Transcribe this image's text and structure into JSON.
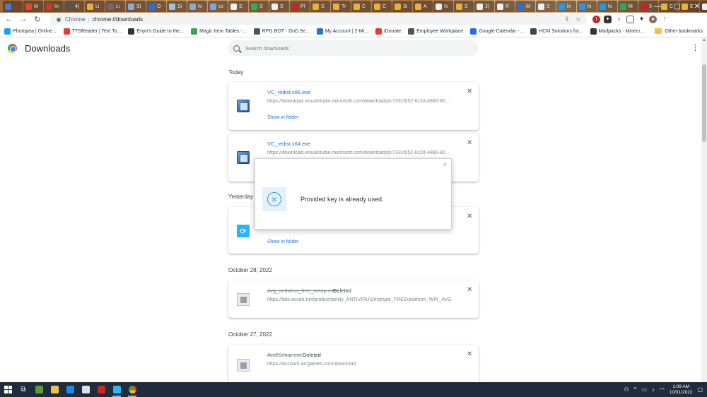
{
  "browser": {
    "tabs": [
      {
        "label": "",
        "color": "#4a76d8"
      },
      {
        "label": "M",
        "color": "#ea4335"
      },
      {
        "label": "In",
        "color": "#cc3a2c"
      },
      {
        "label": "4(",
        "color": "#555555"
      },
      {
        "label": "Li",
        "color": "#e5b13b"
      },
      {
        "label": "Li",
        "color": "#6b6b6b"
      },
      {
        "label": "Sl",
        "color": "#8aa9d6"
      },
      {
        "label": "O",
        "color": "#2a6fd6"
      },
      {
        "label": "Si",
        "color": "#9bc2e6"
      },
      {
        "label": "hi",
        "color": "#8aa9d6"
      },
      {
        "label": "cz",
        "color": "#7aa6d8"
      },
      {
        "label": "S",
        "color": "#eeeeee"
      },
      {
        "label": "S",
        "color": "#1db954"
      },
      {
        "label": "S",
        "color": "#eeeeee"
      },
      {
        "label": "Pl",
        "color": "#cc2222"
      },
      {
        "label": "S",
        "color": "#e5b13b"
      },
      {
        "label": "Tr",
        "color": "#e5b13b"
      },
      {
        "label": "C",
        "color": "#e5b13b"
      },
      {
        "label": "C",
        "color": "#e5b13b"
      },
      {
        "label": "Si",
        "color": "#e5b13b"
      },
      {
        "label": "A",
        "color": "#e5b13b"
      },
      {
        "label": "N",
        "color": "#eeeeee"
      },
      {
        "label": "S",
        "color": "#e5b13b"
      },
      {
        "label": "2(",
        "color": "#eeeeee"
      },
      {
        "label": "R",
        "color": "#eeeeee"
      },
      {
        "label": "M",
        "color": "#2a6fd6"
      },
      {
        "label": "S",
        "color": "#eeeeee"
      },
      {
        "label": "hi",
        "color": "#1d9bf0"
      },
      {
        "label": "hi",
        "color": "#1d9bf0"
      },
      {
        "label": "hi",
        "color": "#1d9bf0"
      },
      {
        "label": "M",
        "color": "#34a853"
      },
      {
        "label": "3",
        "color": "#cc2222"
      },
      {
        "label": "C",
        "color": "#e5b13b"
      },
      {
        "label": "E",
        "color": "#e5b13b"
      },
      {
        "label": "e",
        "color": "#eeeeee"
      },
      {
        "label": "",
        "color": "#ffffff",
        "active": true
      }
    ],
    "omnibox": {
      "scheme_label": "Chrome",
      "separator": "|",
      "url": "chrome://downloads"
    },
    "bookmarks": [
      {
        "label": "Photopea | Online...",
        "color": "#18a0fb"
      },
      {
        "label": "TTSReader | Text To...",
        "color": "#e53935"
      },
      {
        "label": "Enyo's Guide to the...",
        "color": "#333333"
      },
      {
        "label": "Magic Item Tables -...",
        "color": "#34a853"
      },
      {
        "label": "RPG BOT - DnD 5e...",
        "color": "#555555"
      },
      {
        "label": "My Account | 2-Mi...",
        "color": "#2a6fd6"
      },
      {
        "label": "iDonate",
        "color": "#e53935"
      },
      {
        "label": "Employee Workplace",
        "color": "#555555"
      },
      {
        "label": "Google Calendar -...",
        "color": "#1a73e8"
      },
      {
        "label": "HCM Solutions for...",
        "color": "#444444"
      },
      {
        "label": "Modpacks - Minecr...",
        "color": "#333333"
      }
    ],
    "other_bookmarks": "Other bookmarks"
  },
  "page": {
    "title": "Downloads",
    "search_placeholder": "Search downloads",
    "sections": [
      {
        "label": "Today"
      },
      {
        "label": "Yesterday"
      },
      {
        "label": "October 28, 2022"
      },
      {
        "label": "October 27, 2022"
      }
    ],
    "items": [
      {
        "name": "VC_redist.x86.exe",
        "url": "https://download.visualstudio.microsoft.com/download/pr/7331f052-6c2d-4890-80...",
        "action": "Show in folder"
      },
      {
        "name": "VC_redist.x64.exe",
        "url": "https://download.visualstudio.microsoft.com/download/pr/7331f052-6c2d-4890-80..."
      },
      {
        "action": "Show in folder"
      },
      {
        "name": "avg_antivirus_free_setup.exe",
        "status": "Deleted",
        "url": "https://bits.avcdn.net/productfamily_ANTIVIRUS/insttype_FREE/platform_WIN_AVG/..."
      },
      {
        "name": "Arc2Setup.exe",
        "status": "Deleted",
        "url": "https://account.arcgames.com/download"
      }
    ]
  },
  "modal": {
    "message": "Provided key is already used.",
    "close_label": "×",
    "icon": "x-circle-icon",
    "accent_color": "#29a0d8"
  },
  "taskbar": {
    "time": "1:09 AM",
    "date": "10/31/2022"
  }
}
